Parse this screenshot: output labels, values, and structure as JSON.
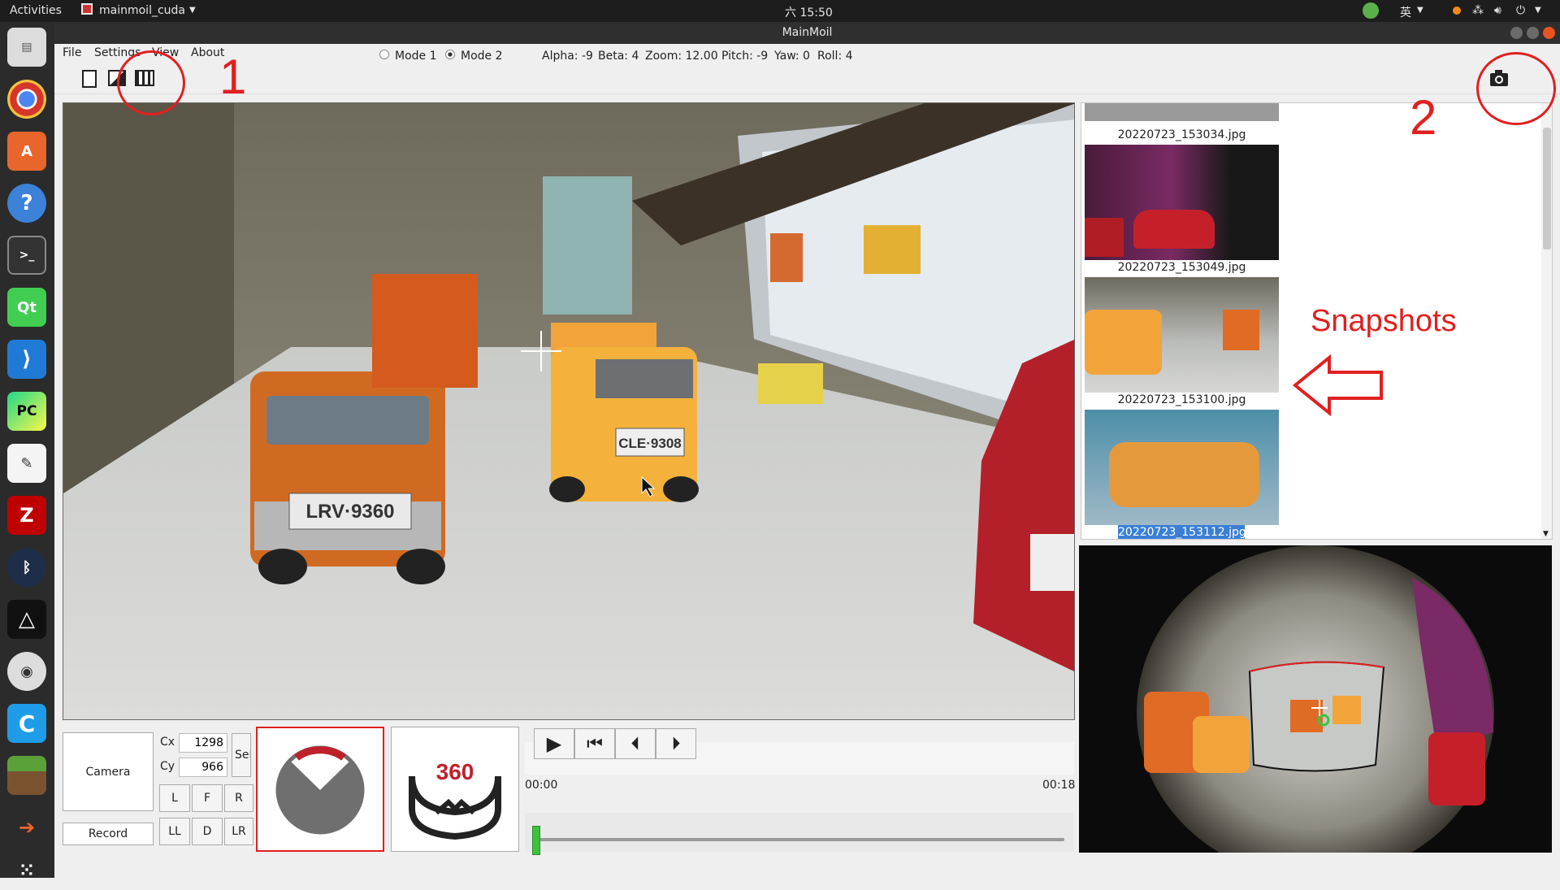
{
  "topbar": {
    "activities": "Activities",
    "app": "mainmoil_cuda",
    "clock": "六 15:50",
    "ime": "英"
  },
  "window": {
    "title": "MainMoil"
  },
  "menu": {
    "file": "File",
    "settings": "Settings",
    "view": "View",
    "about": "About"
  },
  "modes": {
    "mode1": "Mode 1",
    "mode2": "Mode 2",
    "selected": "Mode 2"
  },
  "params": {
    "alpha": "Alpha: -9",
    "beta": "Beta: 4",
    "zoom": "Zoom: 12.00",
    "pitch": "Pitch: -9",
    "yaw": "Yaw: 0",
    "roll": "Roll: 4"
  },
  "annotations": {
    "one": "1",
    "two": "2",
    "snapshots": "Snapshots"
  },
  "main_view": {
    "plate_left": "LRV·9360",
    "plate_center": "CLE·9308"
  },
  "snapshots": [
    {
      "name": "20220723_153034.jpg",
      "selected": false
    },
    {
      "name": "20220723_153049.jpg",
      "selected": false
    },
    {
      "name": "20220723_153100.jpg",
      "selected": false
    },
    {
      "name": "20220723_153112.jpg",
      "selected": true
    }
  ],
  "controls": {
    "camera": "Camera",
    "record": "Record",
    "cx_label": "Cx",
    "cx_value": "1298",
    "cy_label": "Cy",
    "cy_value": "966",
    "set": "Sel",
    "dir_l": "L",
    "dir_f": "F",
    "dir_r": "R",
    "dir_ll": "LL",
    "dir_d": "D",
    "dir_lr": "LR",
    "icon_360": "360"
  },
  "player": {
    "time_start": "00:00",
    "time_end": "00:18",
    "progress": 0.0
  },
  "colors": {
    "accent_red": "#e02020",
    "selection": "#3a7fd5",
    "slider_green": "#3cc33c"
  }
}
